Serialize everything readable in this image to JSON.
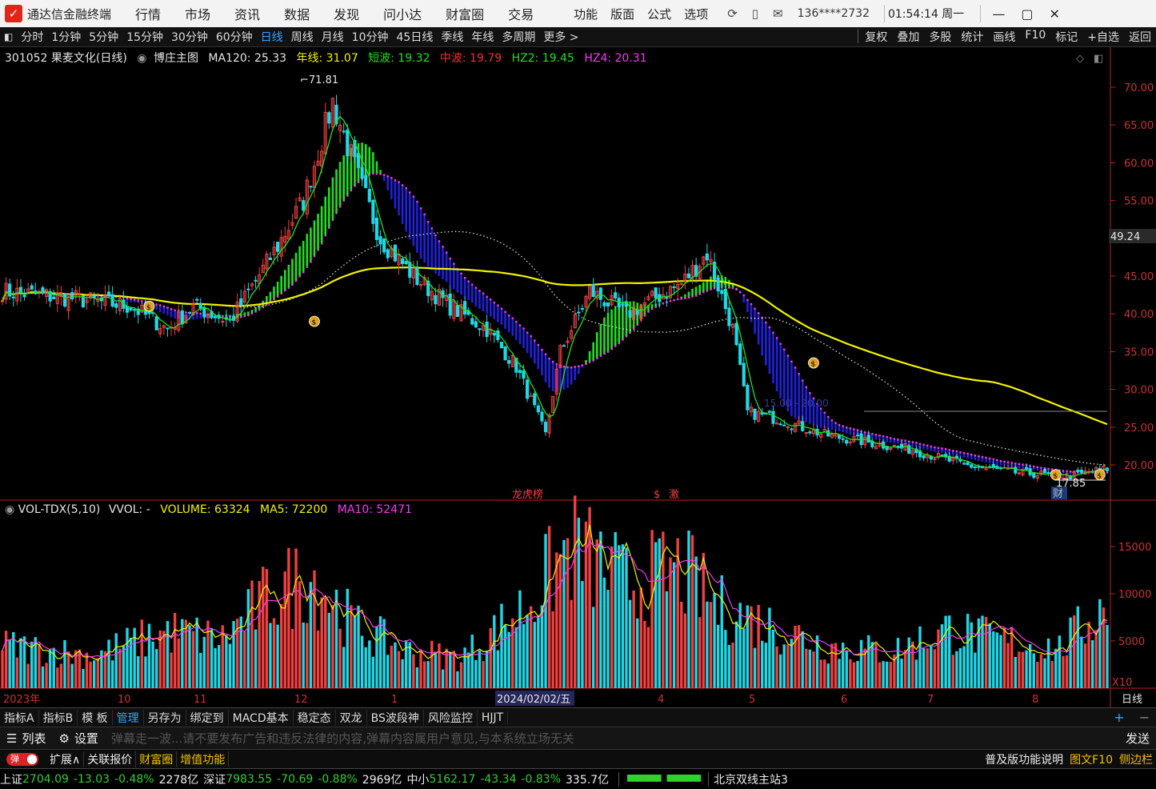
{
  "titlebar": {
    "app_name": "通达信金融终端",
    "menus": [
      "行情",
      "市场",
      "资讯",
      "数据",
      "发现",
      "问小达",
      "财富圈",
      "交易"
    ],
    "functions": [
      "功能",
      "版面",
      "公式",
      "选项"
    ],
    "icons": [
      "refresh-icon",
      "phone-icon",
      "mail-icon"
    ],
    "user": "136****2732",
    "clock": "01:54:14 周一",
    "window_controls": [
      "minimize-icon",
      "restore-icon",
      "close-icon"
    ]
  },
  "periodbar": {
    "periods": [
      "分时",
      "1分钟",
      "5分钟",
      "15分钟",
      "30分钟",
      "60分钟",
      "日线",
      "周线",
      "月线",
      "10分钟",
      "45日线",
      "季线",
      "年线",
      "多周期",
      "更多 >"
    ],
    "active_index": 6,
    "right_items": [
      "复权",
      "叠加",
      "多股",
      "统计",
      "画线",
      "F10",
      "标记",
      "+自选",
      "返回"
    ]
  },
  "main_chart": {
    "header": {
      "code_name": "301052 果麦文化(日线)",
      "indicator": "博庄主图",
      "ma120": "MA120: 25.33",
      "nianxian": "年线: 31.07",
      "duanbo": "短波: 19.32",
      "zhongbo": "中波: 19.79",
      "hz2": "HZ2: 19.45",
      "hz4": "HZ4: 20.31"
    },
    "price_axis_labels": [
      "70.00",
      "65.00",
      "60.00",
      "55.00",
      "50.00",
      "45.00",
      "40.00",
      "35.00",
      "30.00",
      "25.00",
      "20.00"
    ],
    "current_price_tag": "49.24",
    "high_label": "71.81",
    "low_label": "17.85",
    "markers": [
      "龙虎榜",
      "激",
      "财"
    ],
    "faded_label": "15.00 - 20.00"
  },
  "volume_chart": {
    "header": {
      "indicator": "VOL-TDX(5,10)",
      "vvol": "VVOL: -",
      "volume": "VOLUME: 63324",
      "ma5": "MA5: 72200",
      "ma10": "MA10: 52471"
    },
    "axis_labels": [
      "15000",
      "10000",
      "5000"
    ],
    "unit_label": "X10"
  },
  "time_axis": {
    "labels": [
      "2023年",
      "10",
      "11",
      "12",
      "1",
      "2024/02/02/五",
      "4",
      "5",
      "6",
      "7",
      "8"
    ],
    "right_label": "日线"
  },
  "chart_data": {
    "type": "candlestick",
    "symbol": "301052",
    "name": "果麦文化",
    "period": "日线",
    "high": 71.81,
    "low": 17.85,
    "last_price": 19.45,
    "ylim": [
      17,
      72
    ],
    "indicators": {
      "MA120": 25.33,
      "年线": 31.07,
      "短波": 19.32,
      "中波": 19.79,
      "HZ2": 19.45,
      "HZ4": 20.31
    },
    "volume": {
      "VOLUME": 63324,
      "MA5": 72200,
      "MA10": 52471,
      "ylim": [
        0,
        18000
      ],
      "unit": "X10"
    },
    "price_path": [
      [
        0,
        43
      ],
      [
        20,
        42
      ],
      [
        35,
        41
      ],
      [
        45,
        38
      ],
      [
        52,
        41
      ],
      [
        62,
        39
      ],
      [
        75,
        49
      ],
      [
        82,
        55
      ],
      [
        90,
        68
      ],
      [
        97,
        58
      ],
      [
        103,
        50
      ],
      [
        112,
        45
      ],
      [
        122,
        41
      ],
      [
        132,
        38
      ],
      [
        140,
        33
      ],
      [
        148,
        24
      ],
      [
        152,
        35
      ],
      [
        160,
        43
      ],
      [
        170,
        40
      ],
      [
        185,
        44
      ],
      [
        192,
        48
      ],
      [
        199,
        38
      ],
      [
        203,
        27
      ],
      [
        212,
        26
      ],
      [
        224,
        24
      ],
      [
        236,
        23
      ],
      [
        248,
        22
      ],
      [
        262,
        20
      ],
      [
        276,
        19
      ],
      [
        290,
        18.5
      ],
      [
        301,
        19.5
      ]
    ],
    "volume_path": [
      [
        0,
        4500
      ],
      [
        25,
        3500
      ],
      [
        45,
        6000
      ],
      [
        60,
        5200
      ],
      [
        72,
        9500
      ],
      [
        84,
        12000
      ],
      [
        96,
        6500
      ],
      [
        110,
        4000
      ],
      [
        125,
        3200
      ],
      [
        142,
        8500
      ],
      [
        155,
        15000
      ],
      [
        170,
        11000
      ],
      [
        185,
        12500
      ],
      [
        195,
        8500
      ],
      [
        210,
        6500
      ],
      [
        225,
        4500
      ],
      [
        242,
        3800
      ],
      [
        258,
        6200
      ],
      [
        272,
        5000
      ],
      [
        288,
        4200
      ],
      [
        301,
        9000
      ]
    ]
  },
  "tabbar": {
    "tabs": [
      "指标A",
      "指标B",
      "模 板",
      "管理",
      "另存为",
      "绑定到",
      "MACD基本",
      "稳定态",
      "双龙",
      "BS波段神",
      "风险监控",
      "HJJT"
    ],
    "active_index": 3,
    "right_icons": [
      "plus-icon",
      "minus-icon"
    ]
  },
  "danmu": {
    "list_label": "列表",
    "settings_label": "设置",
    "placeholder": "弹幕走一波...请不要发布广告和违反法律的内容,弹幕内容属用户意见,与本系统立场无关",
    "send_label": "发送"
  },
  "toolbar2": {
    "toggle_label": "弹",
    "items": [
      "扩展∧",
      "关联报价",
      "财富圈",
      "增值功能"
    ],
    "right_items": [
      "普及版功能说明",
      "图文F10",
      "侧边栏"
    ]
  },
  "ticker": {
    "sh_label": "上证",
    "sh_value": "2704.09",
    "sh_change": "-13.03",
    "sh_pct": "-0.48%",
    "sh_amount": "2278亿",
    "sz_label": "深证",
    "sz_value": "7983.55",
    "sz_change": "-70.69",
    "sz_pct": "-0.88%",
    "sz_amount": "2969亿",
    "zx_label": "中小",
    "zx_value": "5162.17",
    "zx_change": "-43.34",
    "zx_pct": "-0.83%",
    "zx_amount": "335.7亿",
    "server": "北京双线主站3"
  },
  "colors": {
    "up": "#f24040",
    "down": "#1ed8e6",
    "ma_yellow": "#f2f200",
    "green_band": "#22e022",
    "magenta_band": "#f23cf2",
    "blue_band": "#2020e0",
    "axis_red": "#c02020"
  }
}
